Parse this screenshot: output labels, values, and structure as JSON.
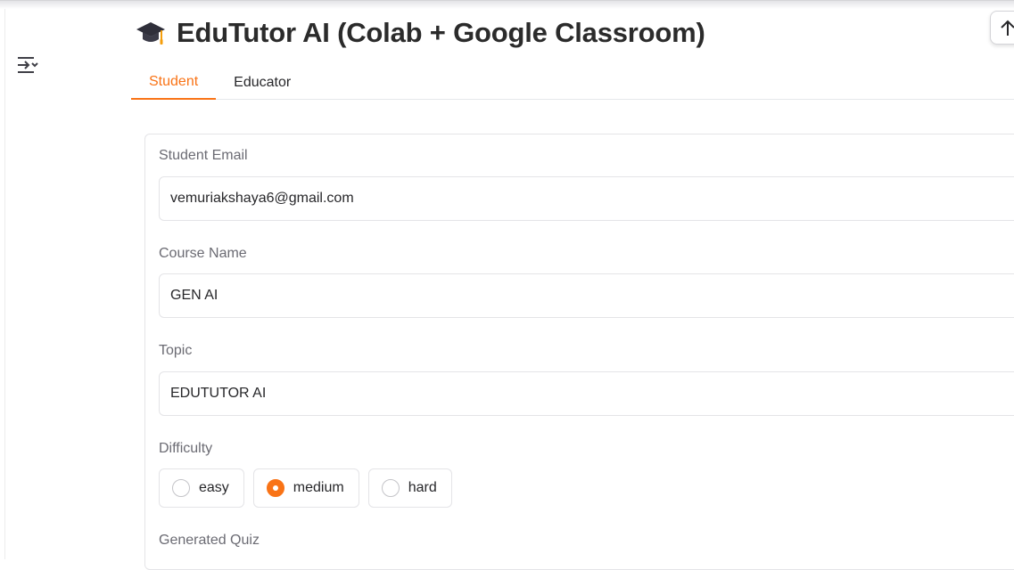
{
  "app": {
    "title": "EduTutor AI (Colab + Google Classroom)",
    "title_icon": "graduation-cap-icon"
  },
  "tabs": [
    {
      "label": "Student",
      "active": true
    },
    {
      "label": "Educator",
      "active": false
    }
  ],
  "form": {
    "email": {
      "label": "Student Email",
      "value": "vemuriakshaya6@gmail.com"
    },
    "course": {
      "label": "Course Name",
      "value": "GEN AI"
    },
    "topic": {
      "label": "Topic",
      "value": "EDUTUTOR AI"
    },
    "difficulty": {
      "label": "Difficulty",
      "options": [
        "easy",
        "medium",
        "hard"
      ],
      "selected": "medium"
    },
    "quiz": {
      "label": "Generated Quiz"
    }
  },
  "colors": {
    "accent": "#f97316",
    "text": "#27272a",
    "muted": "#6b6b73",
    "border": "#e4e4e7"
  },
  "icons": {
    "sidebar_toggle": "sidebar-toggle-icon",
    "scroll_top": "arrow-up-icon"
  }
}
